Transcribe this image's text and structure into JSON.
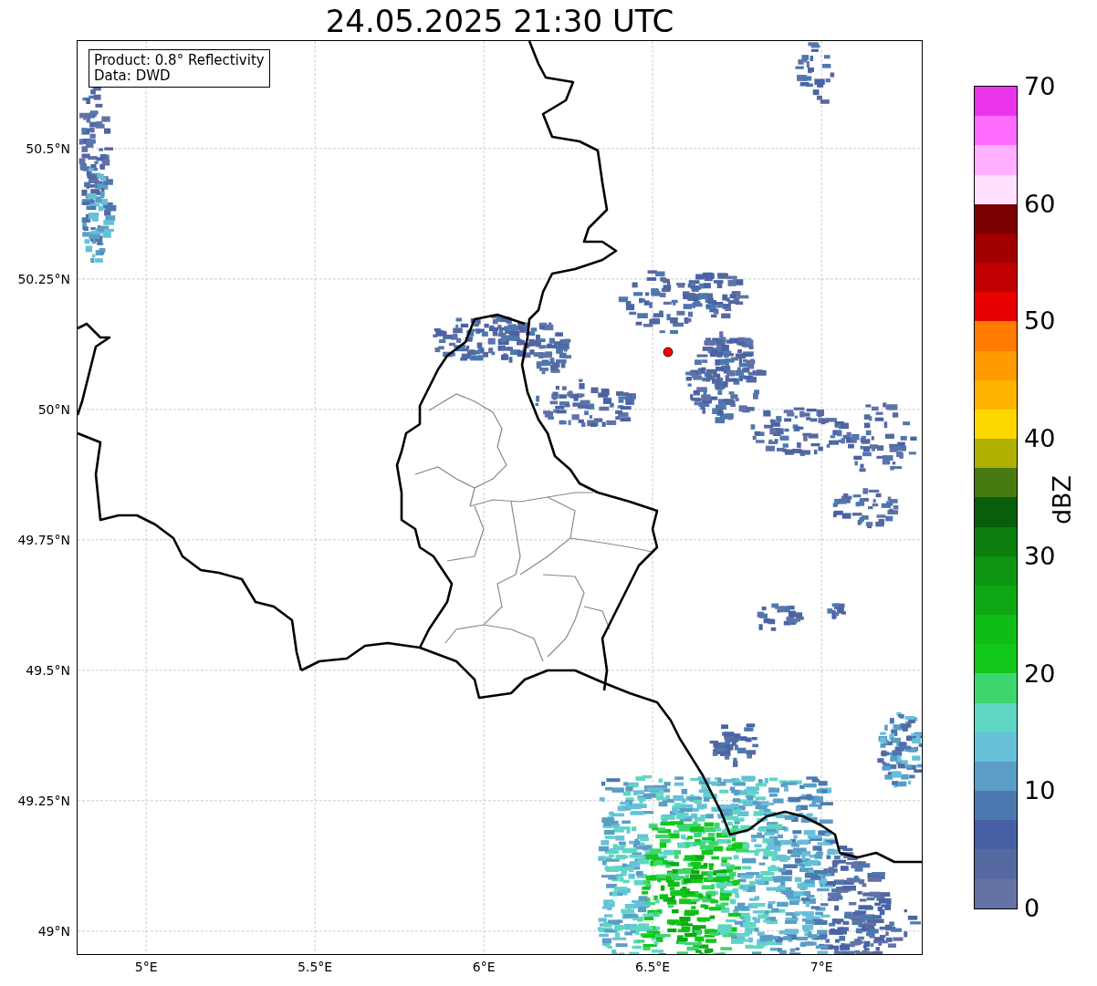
{
  "title": "24.05.2025 21:30 UTC",
  "info_box": [
    "Product: 0.8° Reflectivity",
    "Data: DWD"
  ],
  "lat_ticks": [
    "50.5°N",
    "50.25°N",
    "50°N",
    "49.75°N",
    "49.5°N",
    "49.25°N",
    "49°N"
  ],
  "lon_ticks": [
    "5°E",
    "5.5°E",
    "6°E",
    "6.5°E",
    "7°E"
  ],
  "colorbar": {
    "label": "dBZ",
    "ticks": [
      "70",
      "60",
      "50",
      "40",
      "30",
      "20",
      "10",
      "0"
    ],
    "bins": [
      {
        "color": "#ea34ea"
      },
      {
        "color": "#ff6cff"
      },
      {
        "color": "#ffb0ff"
      },
      {
        "color": "#ffe0ff"
      },
      {
        "color": "#7a0000"
      },
      {
        "color": "#a20000"
      },
      {
        "color": "#c00000"
      },
      {
        "color": "#e60000"
      },
      {
        "color": "#ff7c00"
      },
      {
        "color": "#ff9a00"
      },
      {
        "color": "#ffb400"
      },
      {
        "color": "#ffd700"
      },
      {
        "color": "#b0b000"
      },
      {
        "color": "#477a10"
      },
      {
        "color": "#095e0a"
      },
      {
        "color": "#0c7e10"
      },
      {
        "color": "#0e9512"
      },
      {
        "color": "#0fa814"
      },
      {
        "color": "#10bc18"
      },
      {
        "color": "#12c81a"
      },
      {
        "color": "#3dd66e"
      },
      {
        "color": "#5fd6c4"
      },
      {
        "color": "#66c0da"
      },
      {
        "color": "#5a9ec6"
      },
      {
        "color": "#4c78b0"
      },
      {
        "color": "#4560a4"
      },
      {
        "color": "#55689f"
      },
      {
        "color": "#6472a6"
      }
    ]
  }
}
